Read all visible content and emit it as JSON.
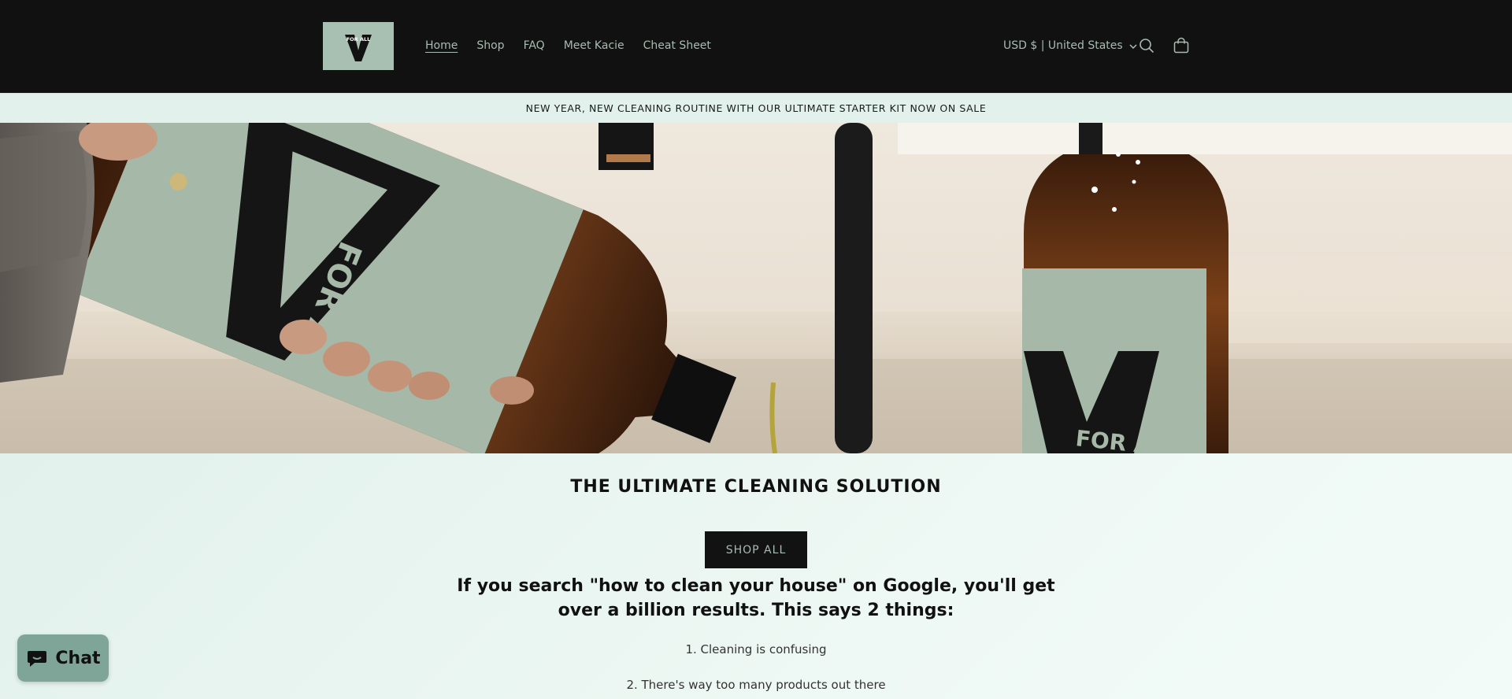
{
  "header": {
    "logo": {
      "text": "FOR ALL",
      "letter": "V",
      "bg": "#a8c0b2"
    },
    "nav": [
      {
        "label": "Home",
        "active": true
      },
      {
        "label": "Shop"
      },
      {
        "label": "FAQ"
      },
      {
        "label": "Meet Kacie"
      },
      {
        "label": "Cheat Sheet"
      }
    ],
    "currency": "USD $ | United States",
    "icons": [
      "search-icon",
      "cart-icon",
      "chevron-down-icon"
    ],
    "bg": "#111111",
    "link_color": "#a9bcb2"
  },
  "announcement": {
    "text": "NEW YEAR, NEW CLEANING ROUTINE WITH OUR ULTIMATE STARTER KIT NOW ON SALE"
  },
  "hero": {
    "bottle_label_text": "FOR ALL",
    "bottle_label_color": "#a6b8a7"
  },
  "main": {
    "headline": "THE ULTIMATE CLEANING SOLUTION",
    "shop_all_label": "SHOP ALL",
    "subhead": "If you search \"how to clean your house\" on Google, you'll get over a billion results. This says 2 things:",
    "points": [
      "1. Cleaning is confusing",
      "2. There's way too many products out there"
    ]
  },
  "chat": {
    "label": "Chat",
    "bg": "#7fa599"
  }
}
